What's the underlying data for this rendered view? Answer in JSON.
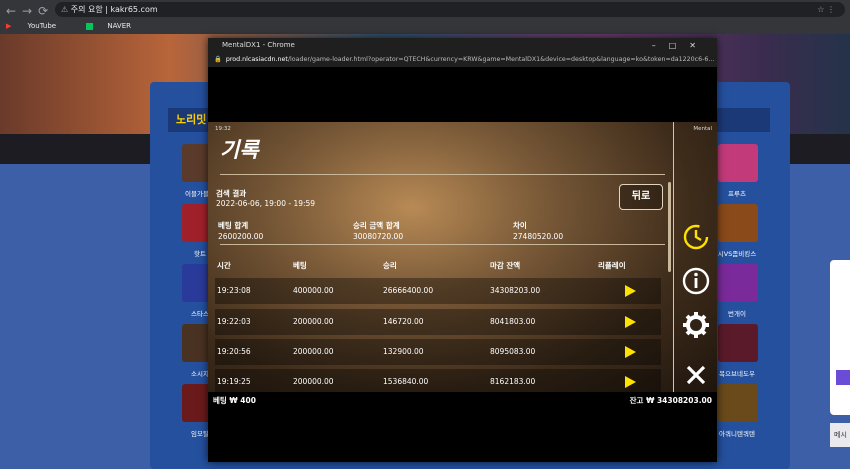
{
  "browser": {
    "security_text": "주의 요함",
    "url": "kakr65.com",
    "bookmarks": [
      "YouTube",
      "NAVER"
    ]
  },
  "site": {
    "section_title": "노리밋",
    "game_labels": [
      "이블가블린",
      "핫트",
      "스타스",
      "소시지",
      "임모탈",
      "프루츠",
      "시VS좀비킹스",
      "번개이",
      "복으브네도우",
      "아쿼니텐쿼텐"
    ]
  },
  "popup": {
    "window_title": "MentalDX1 - Chrome",
    "url_host": "prod.nlcasiacdn.net",
    "url_path": "/loader/game-loader.html?operator=QTECH&currency=KRW&game=MentalDX1&device=desktop&language=ko&token=da1220c6-6..."
  },
  "game": {
    "clock": "19:32",
    "name": "Mental",
    "title": "기록",
    "search_label": "검색 결과",
    "search_range": "2022-06-06, 19:00 - 19:59",
    "back_label": "뒤로",
    "summary": [
      {
        "label": "베팅 합계",
        "value": "2600200.00"
      },
      {
        "label": "승리 금액 합계",
        "value": "30080720.00"
      },
      {
        "label": "차이",
        "value": "27480520.00"
      }
    ],
    "columns": [
      "시간",
      "베팅",
      "승리",
      "마감 잔액",
      "리플레이"
    ],
    "rows": [
      {
        "time": "19:23:08",
        "bet": "400000.00",
        "win": "26666400.00",
        "balance": "34308203.00"
      },
      {
        "time": "19:22:03",
        "bet": "200000.00",
        "win": "146720.00",
        "balance": "8041803.00"
      },
      {
        "time": "19:20:56",
        "bet": "200000.00",
        "win": "132900.00",
        "balance": "8095083.00"
      },
      {
        "time": "19:19:25",
        "bet": "200000.00",
        "win": "1536840.00",
        "balance": "8162183.00"
      }
    ],
    "bet_label": "베팅 ₩ 400",
    "balance_label": "잔고 ₩ 34308203.00"
  },
  "colors": {
    "accent": "#ffe000",
    "panel": "#24509e"
  }
}
